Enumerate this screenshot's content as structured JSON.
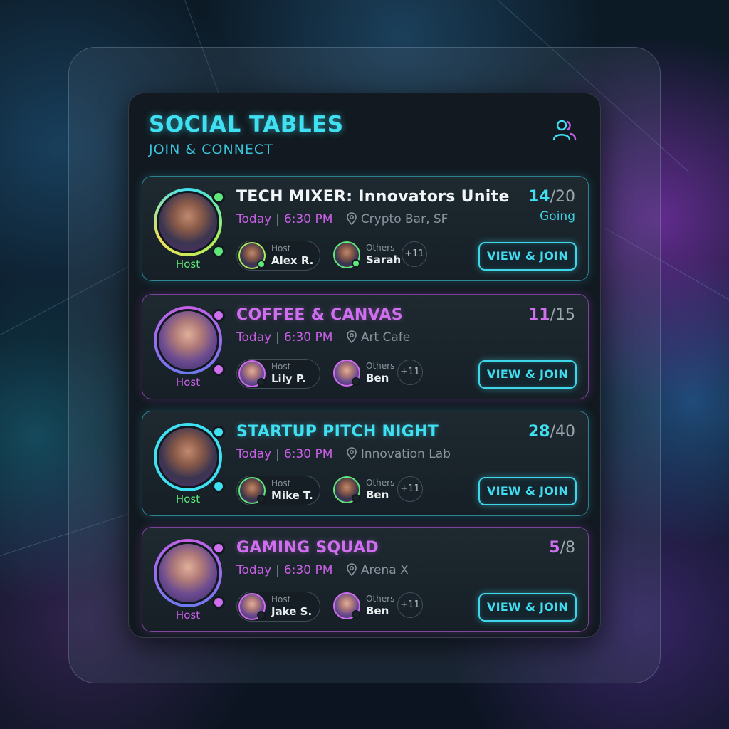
{
  "app": {
    "title": "SOCIAL TABLES",
    "subtitle": "JOIN & CONNECT",
    "header_icon": "people-icon"
  },
  "colors": {
    "cyan_accent": "#3fe0f2",
    "purple_accent": "#c860e6",
    "online_green": "#5ee87a",
    "panel_bg": "#121920"
  },
  "events": [
    {
      "title": "TECH MIXER: Innovators Unite",
      "title_color": "#f2f5f7",
      "theme": "cyan",
      "day": "Today",
      "time": "6:30 PM",
      "location": "Crypto Bar, SF",
      "going_count": "14",
      "capacity": "/20",
      "status": "Going",
      "host_tag": "Host",
      "host_label": "Host",
      "host_name": "Alex R.",
      "others_label": "Others",
      "others_name": "Sarah",
      "more_count": "+11",
      "join_label": "VIEW & JOIN"
    },
    {
      "title": "COFFEE & CANVAS",
      "title_color": "#d06ef0",
      "theme": "purple",
      "day": "Today",
      "time": "6:30 PM",
      "location": "Art Cafe",
      "going_count": "11",
      "capacity": "/15",
      "status": "",
      "host_tag": "Host",
      "host_label": "Host",
      "host_name": "Lily P.",
      "others_label": "Others",
      "others_name": "Ben",
      "more_count": "+11",
      "join_label": "VIEW & JOIN"
    },
    {
      "title": "STARTUP PITCH NIGHT",
      "title_color": "#3fe0f2",
      "theme": "cyan",
      "day": "Today",
      "time": "6:30 PM",
      "location": "Innovation Lab",
      "going_count": "28",
      "capacity": "/40",
      "status": "",
      "host_tag": "Host",
      "host_label": "Host",
      "host_name": "Mike T.",
      "others_label": "Others",
      "others_name": "Ben",
      "more_count": "+11",
      "join_label": "VIEW & JOIN"
    },
    {
      "title": "GAMING SQUAD",
      "title_color": "#d06ef0",
      "theme": "purple",
      "day": "Today",
      "time": "6:30 PM",
      "location": "Arena X",
      "going_count": "5",
      "capacity": "/8",
      "status": "",
      "host_tag": "Host",
      "host_label": "Host",
      "host_name": "Jake S.",
      "others_label": "Others",
      "others_name": "Ben",
      "more_count": "+11",
      "join_label": "VIEW & JOIN"
    }
  ]
}
